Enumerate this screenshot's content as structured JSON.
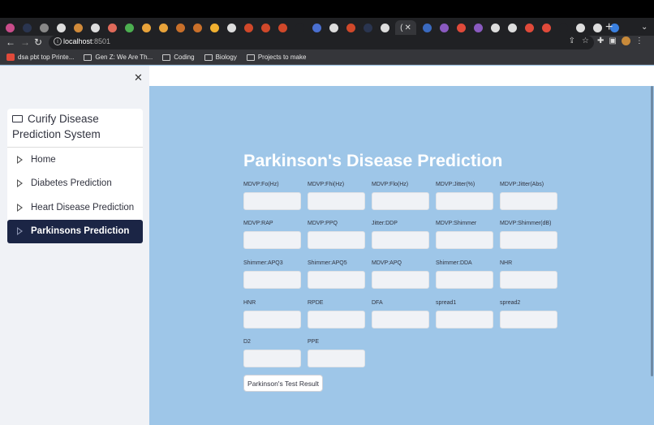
{
  "browser": {
    "url_host": "localhost",
    "url_port": ":8501",
    "active_tab_label": "(",
    "bookmarks": [
      {
        "label": "dsa pbt top Printe...",
        "icon": "gmail-icon"
      },
      {
        "label": "Gen Z: We Are Th...",
        "icon": "folder-icon"
      },
      {
        "label": "Coding",
        "icon": "folder-icon"
      },
      {
        "label": "Biology",
        "icon": "folder-icon"
      },
      {
        "label": "Projects to make",
        "icon": "folder-icon"
      }
    ]
  },
  "sidebar": {
    "close_label": "✕",
    "app_title": "Curify Disease Prediction System",
    "items": [
      {
        "label": "Home",
        "active": false
      },
      {
        "label": "Diabetes Prediction",
        "active": false
      },
      {
        "label": "Heart Disease Prediction",
        "active": false
      },
      {
        "label": "Parkinsons Prediction",
        "active": true
      }
    ]
  },
  "main": {
    "title": "Parkinson's Disease Prediction",
    "fields": [
      {
        "label": "MDVP:Fo(Hz)",
        "value": ""
      },
      {
        "label": "MDVP:Fhi(Hz)",
        "value": ""
      },
      {
        "label": "MDVP:Flo(Hz)",
        "value": ""
      },
      {
        "label": "MDVP:Jitter(%)",
        "value": ""
      },
      {
        "label": "MDVP:Jitter(Abs)",
        "value": ""
      },
      {
        "label": "MDVP:RAP",
        "value": ""
      },
      {
        "label": "MDVP:PPQ",
        "value": ""
      },
      {
        "label": "Jitter:DDP",
        "value": ""
      },
      {
        "label": "MDVP:Shimmer",
        "value": ""
      },
      {
        "label": "MDVP:Shimmer(dB)",
        "value": ""
      },
      {
        "label": "Shimmer:APQ3",
        "value": ""
      },
      {
        "label": "Shimmer:APQ5",
        "value": ""
      },
      {
        "label": "MDVP:APQ",
        "value": ""
      },
      {
        "label": "Shimmer:DDA",
        "value": ""
      },
      {
        "label": "NHR",
        "value": ""
      },
      {
        "label": "HNR",
        "value": ""
      },
      {
        "label": "RPDE",
        "value": ""
      },
      {
        "label": "DFA",
        "value": ""
      },
      {
        "label": "spread1",
        "value": ""
      },
      {
        "label": "spread2",
        "value": ""
      },
      {
        "label": "D2",
        "value": ""
      },
      {
        "label": "PPE",
        "value": ""
      }
    ],
    "submit_label": "Parkinson's Test Result"
  },
  "colors": {
    "main_bg": "#9ec6e8",
    "sidebar_bg": "#f0f2f6",
    "active_item_bg": "#1b2545"
  }
}
